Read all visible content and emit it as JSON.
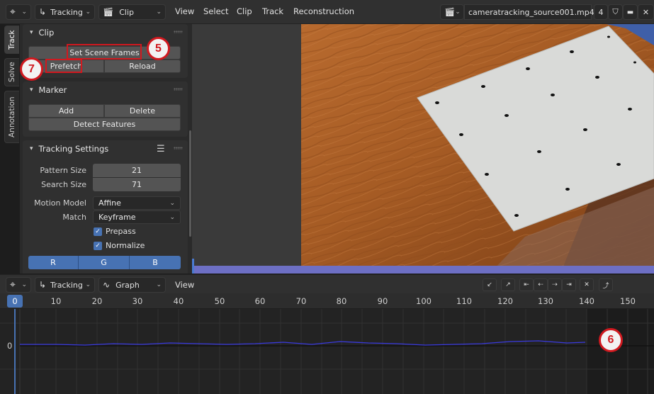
{
  "topbar": {
    "mode_label": "Tracking",
    "view_label": "Clip",
    "menus": [
      "View",
      "Select",
      "Clip",
      "Track",
      "Reconstruction"
    ],
    "clip_name": "cameratracking_source001.mp4",
    "users_count": "4"
  },
  "side_tabs": [
    "Track",
    "Solve",
    "Annotation"
  ],
  "clip_panel": {
    "title": "Clip",
    "set_scene_frames": "Set Scene Frames",
    "prefetch": "Prefetch",
    "reload": "Reload"
  },
  "marker_panel": {
    "title": "Marker",
    "add": "Add",
    "delete": "Delete",
    "detect_features": "Detect Features"
  },
  "tracking_settings": {
    "title": "Tracking Settings",
    "pattern_size_label": "Pattern Size",
    "pattern_size_value": "21",
    "search_size_label": "Search Size",
    "search_size_value": "71",
    "motion_model_label": "Motion Model",
    "motion_model_value": "Affine",
    "match_label": "Match",
    "match_value": "Keyframe",
    "prepass_label": "Prepass",
    "normalize_label": "Normalize",
    "channels": [
      "R",
      "G",
      "B"
    ]
  },
  "annotations": {
    "a5": "5",
    "a6": "6",
    "a7": "7"
  },
  "bottom_header": {
    "mode_label": "Tracking",
    "view_label": "Graph",
    "menu_view": "View"
  },
  "timeline": {
    "current_frame": "0",
    "ticks": [
      "10",
      "20",
      "30",
      "40",
      "50",
      "60",
      "70",
      "80",
      "90",
      "100",
      "110",
      "120",
      "130",
      "140",
      "150"
    ]
  },
  "graph": {
    "y_label": "0"
  },
  "colors": {
    "accent": "#4772b3",
    "annotation_red": "#d0191f",
    "graph_curve": "#3a3adf"
  }
}
